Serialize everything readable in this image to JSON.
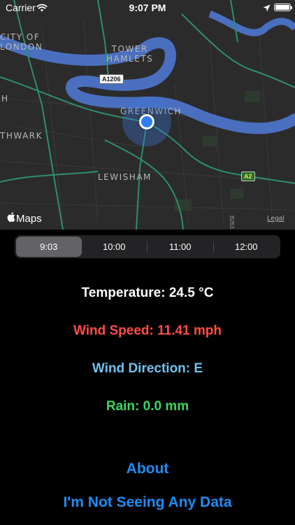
{
  "status_bar": {
    "carrier": "Carrier",
    "time": "9:07 PM",
    "wifi_icon": "wifi-icon",
    "location_icon": "location-arrow-icon",
    "battery_level": 1.0
  },
  "map": {
    "labels": {
      "city_line1": "CITY OF",
      "city_line2": "LONDON",
      "tower_line1": "TOWER",
      "tower_line2": "HAMLETS",
      "greenwich": "GREENWICH",
      "lewisham": "LEWISHAM",
      "southwark": "THWARK",
      "h": "H"
    },
    "roads": {
      "a1206": "A1206",
      "a2": "A2",
      "b263": "B263"
    },
    "attribution": "Maps",
    "legal": "Legal",
    "colors": {
      "river": "#4a6fbf",
      "roads": "#2e8f6a",
      "background": "#2b2b2c",
      "user_dot": "#2f7df6"
    }
  },
  "time_selector": {
    "selected_index": 0,
    "options": [
      "9:03",
      "10:00",
      "11:00",
      "12:00"
    ]
  },
  "readings": {
    "temperature": "Temperature: 24.5 °C",
    "wind_speed": "Wind Speed: 11.41 mph",
    "wind_direction": "Wind Direction: E",
    "rain": "Rain: 0.0 mm"
  },
  "actions": {
    "about": "About",
    "no_data": "I'm Not Seeing Any Data"
  }
}
